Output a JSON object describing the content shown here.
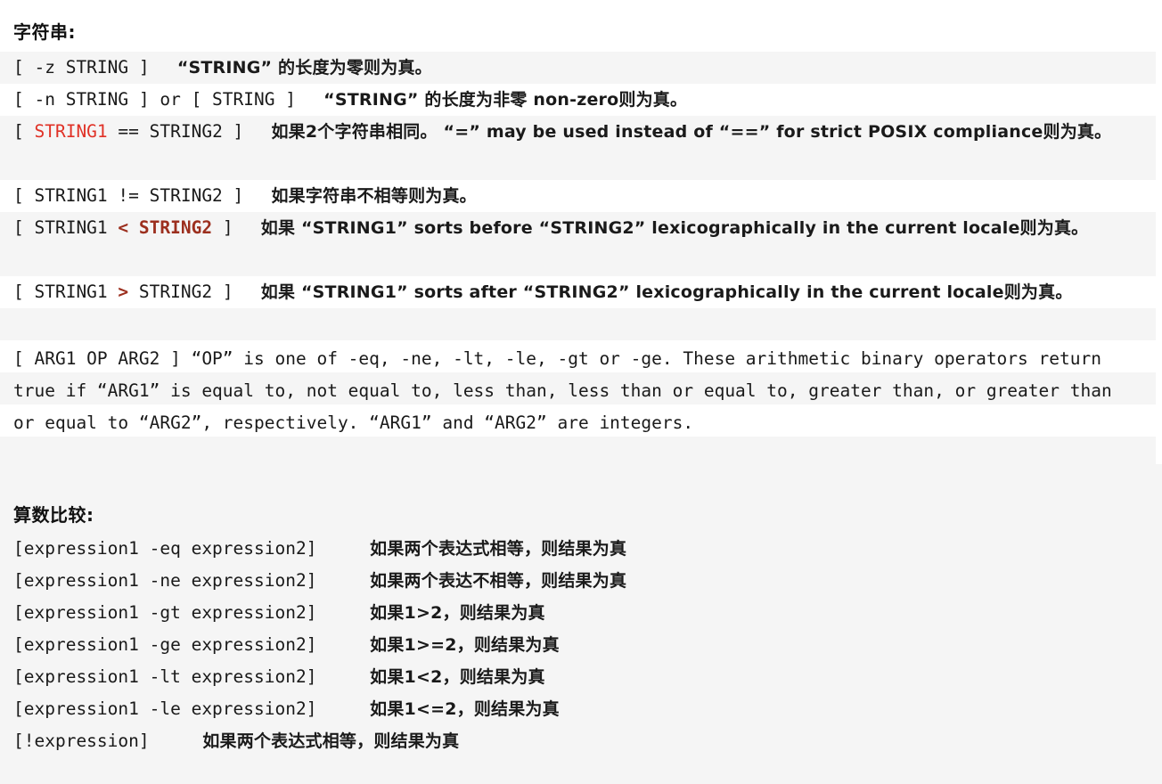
{
  "document": {
    "background_color": "#ffffff",
    "stripe_color": "#f5f5f5",
    "accent_red": "#e03126",
    "accent_maroon": "#9c2f1e",
    "text_color": "#1a1a1a"
  },
  "sections": {
    "strings": {
      "heading": "字符串:",
      "rows": [
        {
          "expr": "[ -z STRING ]",
          "desc": "“STRING” 的长度为零则为真。"
        },
        {
          "expr": "[ -n STRING ] or [ STRING ]",
          "desc": "“STRING” 的长度为非零 non-zero则为真。"
        },
        {
          "expr_pre": "[ ",
          "expr_red": "STRING1",
          "expr_post": " == STRING2 ]",
          "desc": "如果2个字符串相同。 “=” may be used instead of “==” for strict POSIX compliance则为真。"
        },
        {
          "expr": "[ STRING1 != STRING2 ]",
          "desc": "如果字符串不相等则为真。"
        },
        {
          "expr_pre": "[ STRING1 ",
          "expr_bold": "< STRING2",
          "expr_post": " ]",
          "desc": "如果 “STRING1” sorts before “STRING2” lexicographically in the current locale则为真。"
        },
        {
          "expr_pre": "[ STRING1 ",
          "expr_bold": ">",
          "expr_post": " STRING2 ]",
          "desc": "如果 “STRING1” sorts after “STRING2” lexicographically in the current locale则为真。"
        }
      ],
      "paragraph": "[ ARG1 OP ARG2 ] “OP” is one of -eq, -ne, -lt, -le, -gt or -ge. These arithmetic binary operators return true if “ARG1” is equal to, not equal to, less than, less than or equal to, greater than, or greater than or equal to “ARG2”, respectively. “ARG1” and “ARG2” are integers."
    },
    "arithmetic": {
      "heading": "算数比较:",
      "rows": [
        {
          "expr": "[expression1 -eq expression2]",
          "desc": "如果两个表达式相等，则结果为真"
        },
        {
          "expr": "[expression1 -ne expression2]",
          "desc": "如果两个表达不相等，则结果为真"
        },
        {
          "expr": "[expression1 -gt expression2]",
          "desc": "如果1>2，则结果为真"
        },
        {
          "expr": "[expression1 -ge expression2]",
          "desc": "如果1>=2，则结果为真"
        },
        {
          "expr": "[expression1 -lt expression2]",
          "desc": "如果1<2，则结果为真"
        },
        {
          "expr": "[expression1 -le expression2]",
          "desc": "如果1<=2，则结果为真"
        },
        {
          "expr": "[!expression]",
          "desc": "如果两个表达式相等，则结果为真"
        }
      ]
    }
  }
}
